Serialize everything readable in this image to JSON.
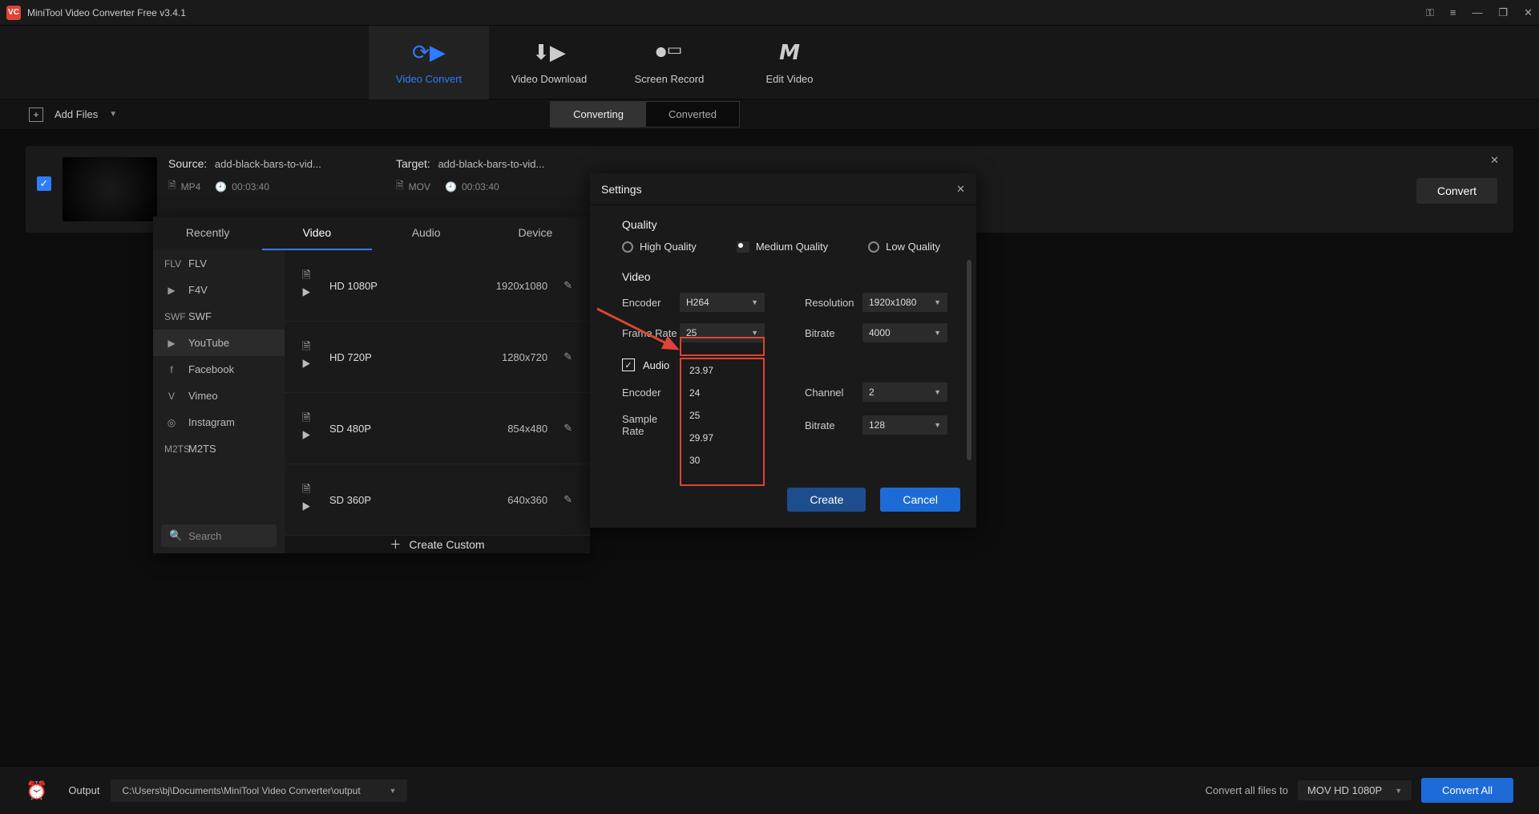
{
  "app": {
    "title": "MiniTool Video Converter Free v3.4.1"
  },
  "mainTabs": {
    "convert": "Video Convert",
    "download": "Video Download",
    "record": "Screen Record",
    "edit": "Edit Video"
  },
  "subhead": {
    "addFiles": "Add Files",
    "converting": "Converting",
    "converted": "Converted"
  },
  "item": {
    "sourceLabel": "Source:",
    "sourceName": "add-black-bars-to-vid...",
    "sourceExt": "MP4",
    "sourceDur": "00:03:40",
    "targetLabel": "Target:",
    "targetName": "add-black-bars-to-vid...",
    "targetExt": "MOV",
    "targetDur": "00:03:40",
    "convert": "Convert"
  },
  "formatPanel": {
    "tabs": {
      "recently": "Recently",
      "video": "Video",
      "audio": "Audio",
      "device": "Device"
    },
    "cats": {
      "flv": "FLV",
      "f4v": "F4V",
      "swf": "SWF",
      "youtube": "YouTube",
      "facebook": "Facebook",
      "vimeo": "Vimeo",
      "instagram": "Instagram",
      "m2ts": "M2TS"
    },
    "searchPlaceholder": "Search",
    "presets": [
      {
        "name": "HD 1080P",
        "res": "1920x1080"
      },
      {
        "name": "HD 720P",
        "res": "1280x720"
      },
      {
        "name": "SD 480P",
        "res": "854x480"
      },
      {
        "name": "SD 360P",
        "res": "640x360"
      }
    ],
    "createCustom": "Create Custom"
  },
  "settings": {
    "title": "Settings",
    "quality": "Quality",
    "qHigh": "High Quality",
    "qMed": "Medium Quality",
    "qLow": "Low Quality",
    "video": "Video",
    "encoder": "Encoder",
    "encoderVal": "H264",
    "resolution": "Resolution",
    "resolutionVal": "1920x1080",
    "frameRate": "Frame Rate",
    "frameRateVal": "25",
    "bitrate": "Bitrate",
    "bitrateVal": "4000",
    "frameRateOptions": [
      "23.97",
      "24",
      "25",
      "29.97",
      "30"
    ],
    "audio": "Audio",
    "aEncoder": "Encoder",
    "channel": "Channel",
    "channelVal": "2",
    "sampleRate": "Sample Rate",
    "aBitrate": "Bitrate",
    "aBitrateVal": "128",
    "create": "Create",
    "cancel": "Cancel"
  },
  "footer": {
    "output": "Output",
    "path": "C:\\Users\\bj\\Documents\\MiniTool Video Converter\\output",
    "convAllLabel": "Convert all files to",
    "convAllVal": "MOV HD 1080P",
    "convAllBtn": "Convert All"
  }
}
